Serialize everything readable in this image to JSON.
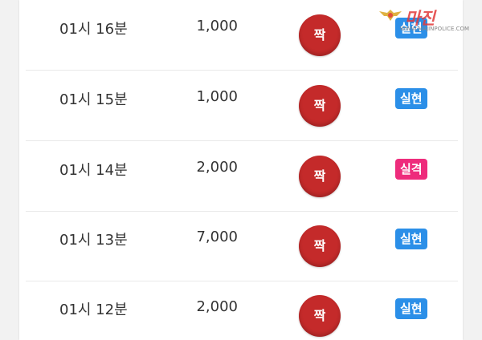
{
  "rows": [
    {
      "time": "01시 16분",
      "amount": "1,000",
      "result": "짝",
      "status": "실현",
      "status_color": "#2b8fe8"
    },
    {
      "time": "01시 15분",
      "amount": "1,000",
      "result": "짝",
      "status": "실현",
      "status_color": "#2b8fe8"
    },
    {
      "time": "01시 14분",
      "amount": "2,000",
      "result": "짝",
      "status": "실격",
      "status_color": "#ee2c7c"
    },
    {
      "time": "01시 13분",
      "amount": "7,000",
      "result": "짝",
      "status": "실현",
      "status_color": "#2b8fe8"
    },
    {
      "time": "01시 12분",
      "amount": "2,000",
      "result": "짝",
      "status": "실현",
      "status_color": "#2b8fe8"
    }
  ],
  "colors": {
    "ball": "#c42a2a",
    "accent_logo": "#e23c3c"
  },
  "logo": {
    "text": "마진 ",
    "url": "WWW.MAJINPOLICE.COM"
  }
}
